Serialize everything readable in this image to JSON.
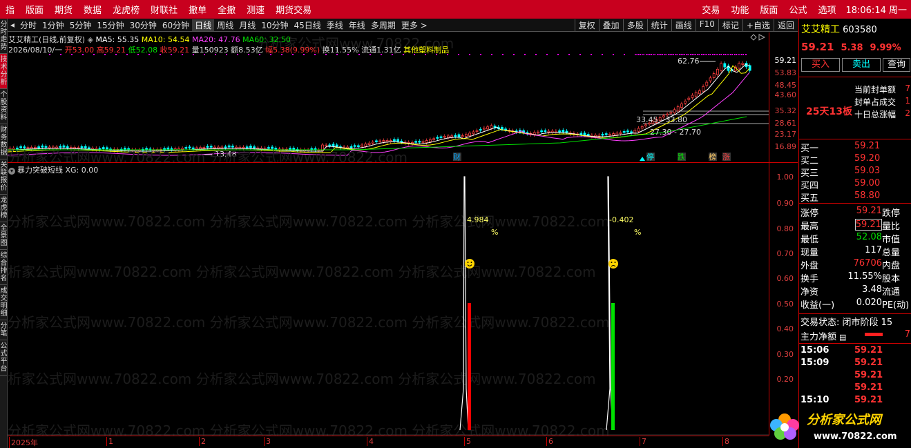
{
  "menubar": {
    "items": [
      "指",
      "版面",
      "期货",
      "数据",
      "龙虎榜",
      "财联社",
      "撤单",
      "全撤",
      "测速",
      "期货交易"
    ],
    "right_items": [
      "交易",
      "功能",
      "版面",
      "公式",
      "选项"
    ],
    "clock": "18:06:14 周一"
  },
  "left_strip": [
    "分时走势",
    "技术分析",
    "个股资料",
    "财务数据",
    "关联报价",
    "龙虎榜",
    "全景图",
    "综合排名",
    "成交明细",
    "分笔",
    "公式平台"
  ],
  "toolbar": {
    "periods": [
      "分时",
      "1分钟",
      "5分钟",
      "15分钟",
      "30分钟",
      "60分钟",
      "日线",
      "周线",
      "月线",
      "10分钟",
      "45日线",
      "季线",
      "年线",
      "多周期",
      "更多 >"
    ],
    "selected": "日线",
    "tools": [
      "复权",
      "叠加",
      "多股",
      "统计",
      "画线",
      "F10",
      "标记",
      "+自选",
      "返回"
    ]
  },
  "kline": {
    "title": "艾艾精工(日线,前复权)",
    "ma5": "MA5: 55.35",
    "ma10": "MA10: 54.54",
    "ma20": "MA20: 47.76",
    "ma60": "MA60: 32.50",
    "date": "2026/08/10/一",
    "open": "开53.00",
    "high": "高59.21",
    "low": "低52.08",
    "close": "收59.21",
    "vol": "量150923",
    "amt": "额8.53亿",
    "pct": "幅5.38(9.99%)",
    "turnover": "换11.55%",
    "float": "流通1.31亿",
    "sector": "其他塑料制品",
    "price_labels": [
      "62.76",
      "33.45",
      "33.80",
      "27.30",
      "27.70",
      "13.48"
    ],
    "axis_ticks": [
      "59.21",
      "53.83",
      "48.45",
      "43.60",
      "35.32",
      "28.61",
      "23.17",
      "16.89"
    ],
    "markers": [
      "财",
      "停",
      "跌",
      "榜",
      "涨"
    ]
  },
  "indicator": {
    "title": "暴力突破短线",
    "xg": "XG: 0.00",
    "label1": "4.984",
    "label2": "-0.402",
    "pct": "%",
    "axis_ticks": [
      "1.00",
      "0.90",
      "0.80",
      "0.70",
      "0.60",
      "0.50",
      "0.40",
      "0.30",
      "0.20"
    ]
  },
  "datebar": [
    "2025年",
    "1",
    "2",
    "3",
    "4",
    "5",
    "6",
    "7",
    "8"
  ],
  "right_panel": {
    "name": "艾艾精工",
    "code": "603580",
    "price": "59.21",
    "change": "5.38",
    "pct": "9.99%",
    "btn_buy": "买入",
    "btn_sell": "卖出",
    "btn_query": "查询",
    "seal_labels": [
      "当前封单额",
      "封单占成交",
      "十日总涨幅"
    ],
    "seal_vals": [
      "7",
      "1",
      "2"
    ],
    "streak": "25天13板",
    "asks": [
      {
        "l": "买一",
        "p": "59.21"
      },
      {
        "l": "买二",
        "p": "59.20"
      },
      {
        "l": "买三",
        "p": "59.03"
      },
      {
        "l": "买四",
        "p": "59.00"
      },
      {
        "l": "买五",
        "p": "58.80"
      }
    ],
    "stats": [
      {
        "l": "涨停",
        "v": "59.21",
        "l2": "跌停"
      },
      {
        "l": "最高",
        "v": "59.21",
        "l2": "量比"
      },
      {
        "l": "最低",
        "v": "52.08",
        "l2": "市值"
      },
      {
        "l": "现量",
        "v": "117",
        "l2": "总量"
      },
      {
        "l": "外盘",
        "v": "76706",
        "l2": "内盘"
      },
      {
        "l": "换手",
        "v": "11.55%",
        "l2": "股本"
      },
      {
        "l": "净资",
        "v": "3.48",
        "l2": "流通"
      },
      {
        "l": "收益(一)",
        "v": "0.020",
        "l2": "PE(动)"
      }
    ],
    "status": "交易状态: 闭市阶段 15",
    "main_force": "主力净额",
    "main_force_val": "7",
    "ticks": [
      {
        "t": "15:06",
        "p": "59.21"
      },
      {
        "t": "15:09",
        "p": "59.21"
      },
      {
        "t": "",
        "p": "59.21"
      },
      {
        "t": "",
        "p": "59.21"
      },
      {
        "t": "15:10",
        "p": "59.21"
      }
    ]
  },
  "logo": {
    "text": "分析家公式网",
    "url": "www.70822.com"
  },
  "watermark": "分析家公式网www.70822.com"
}
